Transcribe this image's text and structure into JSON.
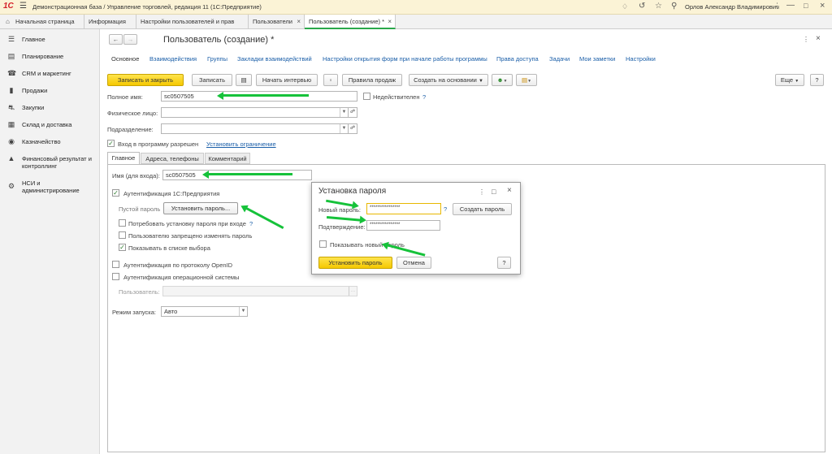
{
  "titlebar": {
    "logo": "1С",
    "menu": "☰",
    "title": "Демонстрационная база / Управление торговлей, редакция 11  (1С:Предприятие)",
    "user": "Орлов Александр Владимирович"
  },
  "tabs": [
    {
      "label": "Начальная страница"
    },
    {
      "label": "Информация"
    },
    {
      "label": "Настройки пользователей и прав"
    },
    {
      "label": "Пользователи"
    },
    {
      "label": "Пользователь (создание) *"
    }
  ],
  "tab_close": "×",
  "sidebar": {
    "items": [
      {
        "label": "Главное"
      },
      {
        "label": "Планирование"
      },
      {
        "label": "CRM и маркетинг"
      },
      {
        "label": "Продажи"
      },
      {
        "label": "Закупки"
      },
      {
        "label": "Склад и доставка"
      },
      {
        "label": "Казначейство"
      },
      {
        "label": "Финансовый результат и контроллинг"
      },
      {
        "label": "НСИ и администрирование"
      }
    ]
  },
  "form": {
    "title": "Пользователь (создание) *",
    "nav_links": [
      "Основное",
      "Взаимодействия",
      "Группы",
      "Закладки взаимодействий",
      "Настройки открытия форм при начале работы программы",
      "Права доступа",
      "Задачи",
      "Мои заметки",
      "Настройки"
    ],
    "toolbar": {
      "save_close": "Записать и закрыть",
      "save": "Записать",
      "start_interview": "Начать интервью",
      "sales_rules": "Правила продаж",
      "create_based": "Создать на основании",
      "more": "Еще",
      "help": "?"
    },
    "full_name_label": "Полное имя:",
    "full_name_value": "sc0507505",
    "invalid_label": "Недействителен",
    "hint": "?",
    "individual_label": "Физическое лицо:",
    "department_label": "Подразделение:",
    "login_label": "Вход в программу разрешен",
    "restrict_link": "Установить ограничение",
    "inner_tabs": [
      "Главное",
      "Адреса, телефоны",
      "Комментарий"
    ],
    "login_name_label": "Имя (для входа):",
    "login_name_value": "sc0507505",
    "auth_1c": "Аутентификация 1С:Предприятия",
    "empty_password": "Пустой пароль",
    "set_password": "Установить пароль...",
    "require_change": "Потребовать установку пароля при входе",
    "forbid_change": "Пользователю запрещено изменять пароль",
    "show_in_list": "Показывать в списке выбора",
    "auth_openid": "Аутентификация по протоколу OpenID",
    "auth_os": "Аутентификация операционной системы",
    "os_user_label": "Пользователь:",
    "mode_label": "Режим запуска:",
    "mode_value": "Авто"
  },
  "dialog": {
    "title": "Установка пароля",
    "new_pwd_label": "Новый пароль:",
    "new_pwd_value": "****************",
    "hint": "?",
    "create_pwd": "Создать пароль",
    "confirm_label": "Подтверждение:",
    "confirm_value": "****************",
    "show_pwd": "Показывать новый пароль",
    "set_btn": "Установить пароль",
    "cancel_btn": "Отмена",
    "help": "?"
  },
  "colors": {
    "accent": "#2ba84a",
    "button_yellow": "#f5c800",
    "link": "#1a5ea8",
    "annotation_arrow": "#16c23a"
  }
}
